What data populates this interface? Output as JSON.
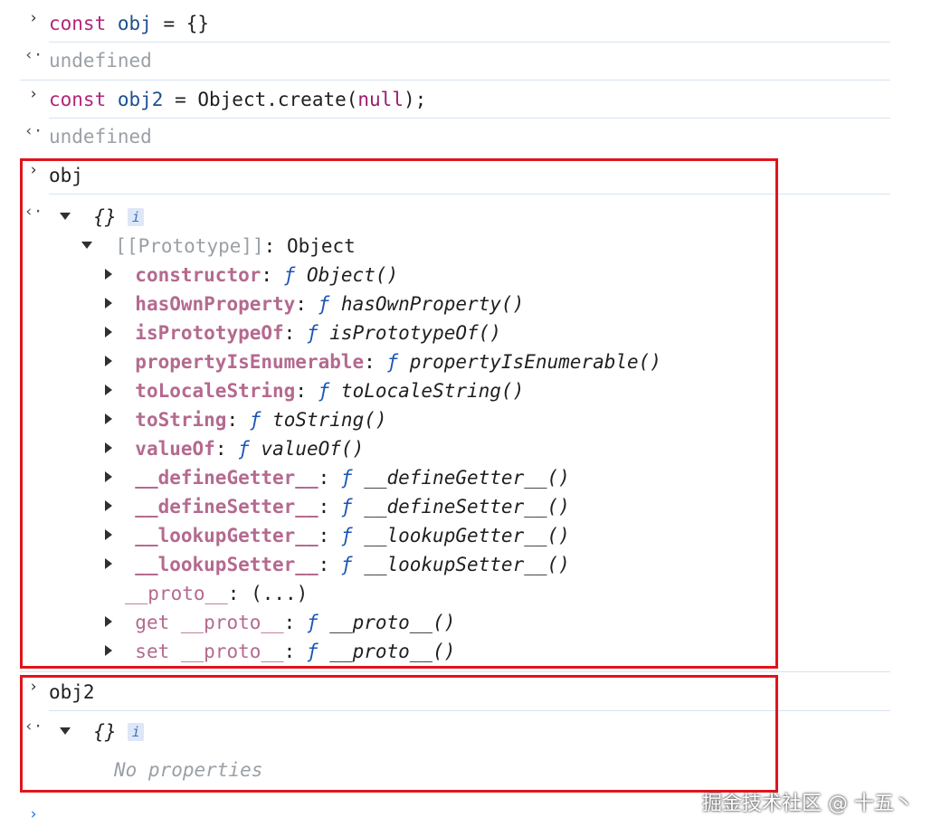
{
  "gutter": {
    "input": "›",
    "output": "‹·",
    "prompt": "›"
  },
  "entries": [
    {
      "kw": "const",
      "var": "obj",
      "rest": " = {}"
    },
    {
      "result": "undefined"
    },
    {
      "kw": "const",
      "var": "obj2",
      "rest1": " = Object.create(",
      "null": "null",
      "rest2": ");"
    },
    {
      "result": "undefined"
    }
  ],
  "obj": {
    "input": "obj",
    "summary": "{}",
    "badge": "i",
    "prototype_label": "[[Prototype]]",
    "prototype_value": ": Object",
    "props": [
      {
        "key": "constructor",
        "fn": "Object()"
      },
      {
        "key": "hasOwnProperty",
        "fn": "hasOwnProperty()"
      },
      {
        "key": "isPrototypeOf",
        "fn": "isPrototypeOf()"
      },
      {
        "key": "propertyIsEnumerable",
        "fn": "propertyIsEnumerable()"
      },
      {
        "key": "toLocaleString",
        "fn": "toLocaleString()"
      },
      {
        "key": "toString",
        "fn": "toString()"
      },
      {
        "key": "valueOf",
        "fn": "valueOf()"
      },
      {
        "key": "__defineGetter__",
        "fn": "__defineGetter__()"
      },
      {
        "key": "__defineSetter__",
        "fn": "__defineSetter__()"
      },
      {
        "key": "__lookupGetter__",
        "fn": "__lookupGetter__()"
      },
      {
        "key": "__lookupSetter__",
        "fn": "__lookupSetter__()"
      }
    ],
    "proto_key": "__proto__",
    "proto_value": ": (...)",
    "accessors": [
      {
        "key": "get __proto__",
        "fn": "__proto__()"
      },
      {
        "key": "set __proto__",
        "fn": "__proto__()"
      }
    ],
    "f_symbol": "ƒ"
  },
  "obj2": {
    "input": "obj2",
    "summary": "{}",
    "badge": "i",
    "empty": "No properties"
  },
  "watermark": "掘金技术社区 @ 十五丶"
}
